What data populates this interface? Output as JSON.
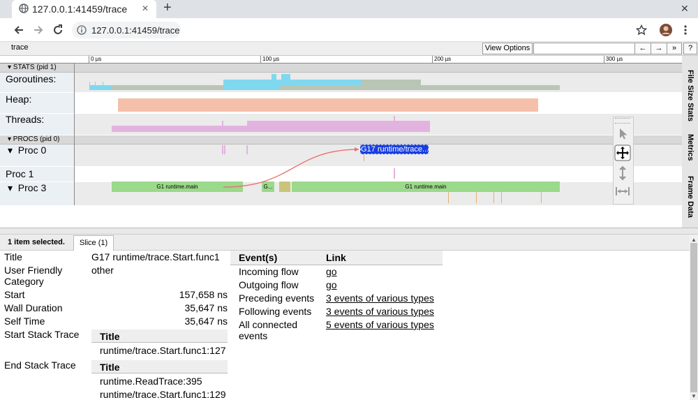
{
  "browser": {
    "tab_title": "127.0.0.1:41459/trace",
    "new_tab_glyph": "+",
    "close_glyph": "✕",
    "url": "127.0.0.1:41459/trace"
  },
  "trace_header": {
    "title": "trace",
    "view_options": "View Options",
    "search_value": "",
    "prev_label": "←",
    "next_label": "→",
    "more_label": "»",
    "help_label": "?"
  },
  "ruler": {
    "ticks": [
      "0 µs",
      "100 µs",
      "200 µs",
      "300 µs"
    ]
  },
  "stats": {
    "group_label": "▾ STATS (pid 1)",
    "rows": [
      "Goroutines:",
      "Heap:",
      "Threads:"
    ]
  },
  "procs": {
    "group_label": "▾ PROCS (pid 0)",
    "proc0": "▾  Proc 0",
    "proc1": "Proc 1",
    "proc3": "▾  Proc 3",
    "slices": {
      "selected": "G17 runtime/trace...",
      "main_left": "G1 runtime.main",
      "small": "G...",
      "main_right": "G1 runtime.main"
    }
  },
  "side_tabs": [
    "File Size Stats",
    "Metrics",
    "Frame Data"
  ],
  "selection": {
    "count_label": "1 item selected.",
    "tab_label": "Slice (1)",
    "fields": {
      "title_label": "Title",
      "title_value": "G17 runtime/trace.Start.func1",
      "category_label": "User Friendly Category",
      "category_value": "other",
      "start_label": "Start",
      "start_value": "157,658 ns",
      "wall_label": "Wall Duration",
      "wall_value": "35,647 ns",
      "self_label": "Self Time",
      "self_value": "35,647 ns",
      "start_stack_label": "Start Stack Trace",
      "start_stack_header": "Title",
      "start_stack": [
        "runtime/trace.Start.func1:127"
      ],
      "end_stack_label": "End Stack Trace",
      "end_stack_header": "Title",
      "end_stack": [
        "runtime.ReadTrace:395",
        "runtime/trace.Start.func1:129"
      ]
    },
    "events": {
      "header_events": "Event(s)",
      "header_link": "Link",
      "rows": [
        {
          "label": "Incoming flow",
          "link": "go"
        },
        {
          "label": "Outgoing flow",
          "link": "go"
        },
        {
          "label": "Preceding events",
          "link": "3 events of various types"
        },
        {
          "label": "Following events",
          "link": "3 events of various types"
        },
        {
          "label": "All connected events",
          "link": "5 events of various types"
        }
      ]
    }
  },
  "colors": {
    "goroutines": "#80d8ef",
    "goroutines_grey": "#b9c6b6",
    "heap": "#f4c0aa",
    "threads": "#e3b3e0",
    "slice_green": "#9bd98b",
    "slice_selected": "#1a3fe0",
    "flow_arrow": "#ef6b6b"
  },
  "icons": [
    "info-icon",
    "back-arrow-icon",
    "forward-arrow-icon",
    "reload-icon",
    "star-icon",
    "profile-avatar-icon",
    "menu-dots-icon",
    "pointer-tool-icon",
    "pan-tool-icon",
    "zoom-tool-icon",
    "timing-tool-icon"
  ]
}
